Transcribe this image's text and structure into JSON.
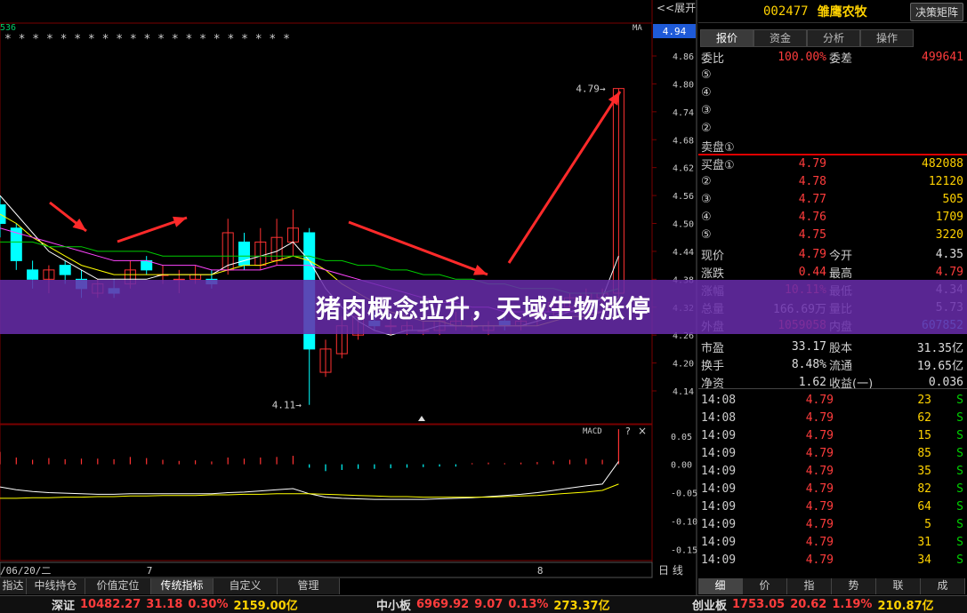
{
  "header": {
    "left_code": "536",
    "ma_label": "MA",
    "expand_label": "<<展开",
    "current_price_badge": "4.94"
  },
  "stock": {
    "code": "002477",
    "name": "雏鹰农牧",
    "decision_btn": "决策矩阵"
  },
  "right_tabs": [
    "报价",
    "资金",
    "分析",
    "操作"
  ],
  "order_ratio": {
    "label1": "委比",
    "value1": "100.00%",
    "label2": "委差",
    "value2": "499641"
  },
  "sell_levels": [
    {
      "label": "⑤",
      "price": "",
      "qty": ""
    },
    {
      "label": "④",
      "price": "",
      "qty": ""
    },
    {
      "label": "③",
      "price": "",
      "qty": ""
    },
    {
      "label": "②",
      "price": "",
      "qty": ""
    },
    {
      "label": "卖盘①",
      "price": "",
      "qty": ""
    }
  ],
  "buy_levels": [
    {
      "label": "买盘①",
      "price": "4.79",
      "qty": "482088"
    },
    {
      "label": "②",
      "price": "4.78",
      "qty": "12120"
    },
    {
      "label": "③",
      "price": "4.77",
      "qty": "505"
    },
    {
      "label": "④",
      "price": "4.76",
      "qty": "1709"
    },
    {
      "label": "⑤",
      "price": "4.75",
      "qty": "3220"
    }
  ],
  "quote_rows": [
    {
      "l1": "现价",
      "v1": "4.79",
      "c1": "red",
      "l2": "今开",
      "v2": "4.35",
      "c2": "wht"
    },
    {
      "l1": "涨跌",
      "v1": "0.44",
      "c1": "red",
      "l2": "最高",
      "v2": "4.79",
      "c2": "red"
    },
    {
      "l1": "涨幅",
      "v1": "10.11%",
      "c1": "red",
      "l2": "最低",
      "v2": "4.34",
      "c2": "wht"
    },
    {
      "l1": "总量",
      "v1": "166.69万",
      "c1": "wht",
      "l2": "量比",
      "v2": "5.73",
      "c2": "wht"
    },
    {
      "l1": "外盘",
      "v1": "1059058",
      "c1": "red",
      "l2": "内盘",
      "v2": "607852",
      "c2": "cyn"
    },
    {
      "l1": "市盈",
      "v1": "33.17",
      "c1": "wht",
      "l2": "股本",
      "v2": "31.35亿",
      "c2": "wht"
    },
    {
      "l1": "换手",
      "v1": "8.48%",
      "c1": "wht",
      "l2": "流通",
      "v2": "19.65亿",
      "c2": "wht"
    },
    {
      "l1": "净资",
      "v1": "1.62",
      "c1": "wht",
      "l2": "收益(一)",
      "v2": "0.036",
      "c2": "wht"
    }
  ],
  "ticks": [
    {
      "time": "14:08",
      "price": "4.79",
      "qty": "23",
      "side": "S"
    },
    {
      "time": "14:08",
      "price": "4.79",
      "qty": "62",
      "side": "S"
    },
    {
      "time": "14:09",
      "price": "4.79",
      "qty": "15",
      "side": "S"
    },
    {
      "time": "14:09",
      "price": "4.79",
      "qty": "85",
      "side": "S"
    },
    {
      "time": "14:09",
      "price": "4.79",
      "qty": "35",
      "side": "S"
    },
    {
      "time": "14:09",
      "price": "4.79",
      "qty": "82",
      "side": "S"
    },
    {
      "time": "14:09",
      "price": "4.79",
      "qty": "64",
      "side": "S"
    },
    {
      "time": "14:09",
      "price": "4.79",
      "qty": "5",
      "side": "S"
    },
    {
      "time": "14:09",
      "price": "4.79",
      "qty": "31",
      "side": "S"
    },
    {
      "time": "14:09",
      "price": "4.79",
      "qty": "34",
      "side": "S"
    }
  ],
  "banner": "猪肉概念拉升，天域生物涨停",
  "bottom_tabs": [
    "指达",
    "中线持仓",
    "价值定位",
    "传统指标",
    "自定义",
    "管理"
  ],
  "right_bottom_tabs": [
    "细",
    "价",
    "指",
    "势",
    "联",
    "成"
  ],
  "status_bar": {
    "sz_label": "深证",
    "sz_index": "10482.27",
    "sz_chg": "31.18",
    "sz_pct": "0.30%",
    "sz_amt": "2159.00亿",
    "zx_label": "中小板",
    "zx_index": "6969.92",
    "zx_chg": "9.07",
    "zx_pct": "0.13%",
    "zx_amt": "273.37亿",
    "cy_label": "创业板",
    "cy_index": "1753.05",
    "cy_chg": "20.62",
    "cy_pct": "1.19%",
    "cy_amt": "210.87亿"
  },
  "chart_data": [
    {
      "type": "candlestick",
      "title": "",
      "y_ticks": [
        "4.86",
        "4.80",
        "4.74",
        "4.68",
        "4.62",
        "4.56",
        "4.50",
        "4.44",
        "4.38",
        "4.32",
        "4.26",
        "4.20",
        "4.14"
      ],
      "x_labels": [
        {
          "label": "/06/20/二",
          "idx": 0
        },
        {
          "label": "7",
          "idx": 9
        },
        {
          "label": "8",
          "idx": 33
        }
      ],
      "period_label": "日 线",
      "star_marks": "*  *  *        *  *          *            *  *  *  *          *  *  *  *  *  *  *  *          *  *        *",
      "high_annotation": "4.79",
      "low_annotation": "4.11",
      "candles": [
        {
          "o": 4.54,
          "h": 4.56,
          "c": 4.5,
          "l": 4.47
        },
        {
          "o": 4.49,
          "h": 4.5,
          "c": 4.42,
          "l": 4.4
        },
        {
          "o": 4.4,
          "h": 4.42,
          "c": 4.38,
          "l": 4.36
        },
        {
          "o": 4.38,
          "h": 4.41,
          "c": 4.4,
          "l": 4.35
        },
        {
          "o": 4.41,
          "h": 4.42,
          "c": 4.39,
          "l": 4.37
        },
        {
          "o": 4.38,
          "h": 4.4,
          "c": 4.36,
          "l": 4.34
        },
        {
          "o": 4.35,
          "h": 4.38,
          "c": 4.37,
          "l": 4.34
        },
        {
          "o": 4.36,
          "h": 4.38,
          "c": 4.35,
          "l": 4.34
        },
        {
          "o": 4.37,
          "h": 4.42,
          "c": 4.4,
          "l": 4.36
        },
        {
          "o": 4.42,
          "h": 4.43,
          "c": 4.4,
          "l": 4.39
        },
        {
          "o": 4.39,
          "h": 4.41,
          "c": 4.39,
          "l": 4.37
        },
        {
          "o": 4.38,
          "h": 4.4,
          "c": 4.38,
          "l": 4.35
        },
        {
          "o": 4.38,
          "h": 4.41,
          "c": 4.39,
          "l": 4.37
        },
        {
          "o": 4.38,
          "h": 4.4,
          "c": 4.37,
          "l": 4.36
        },
        {
          "o": 4.4,
          "h": 4.51,
          "c": 4.48,
          "l": 4.39
        },
        {
          "o": 4.46,
          "h": 4.48,
          "c": 4.41,
          "l": 4.4
        },
        {
          "o": 4.41,
          "h": 4.49,
          "c": 4.46,
          "l": 4.4
        },
        {
          "o": 4.42,
          "h": 4.51,
          "c": 4.47,
          "l": 4.41
        },
        {
          "o": 4.46,
          "h": 4.53,
          "c": 4.49,
          "l": 4.43
        },
        {
          "o": 4.48,
          "h": 4.49,
          "c": 4.23,
          "l": 4.11
        },
        {
          "o": 4.18,
          "h": 4.25,
          "c": 4.23,
          "l": 4.17
        },
        {
          "o": 4.22,
          "h": 4.3,
          "c": 4.28,
          "l": 4.21
        },
        {
          "o": 4.26,
          "h": 4.32,
          "c": 4.3,
          "l": 4.25
        },
        {
          "o": 4.29,
          "h": 4.31,
          "c": 4.28,
          "l": 4.27
        },
        {
          "o": 4.28,
          "h": 4.3,
          "c": 4.28,
          "l": 4.26
        },
        {
          "o": 4.27,
          "h": 4.29,
          "c": 4.28,
          "l": 4.26
        },
        {
          "o": 4.27,
          "h": 4.29,
          "c": 4.27,
          "l": 4.26
        },
        {
          "o": 4.27,
          "h": 4.3,
          "c": 4.29,
          "l": 4.26
        },
        {
          "o": 4.28,
          "h": 4.31,
          "c": 4.29,
          "l": 4.27
        },
        {
          "o": 4.28,
          "h": 4.3,
          "c": 4.28,
          "l": 4.27
        },
        {
          "o": 4.27,
          "h": 4.29,
          "c": 4.28,
          "l": 4.26
        },
        {
          "o": 4.29,
          "h": 4.3,
          "c": 4.28,
          "l": 4.27
        },
        {
          "o": 4.28,
          "h": 4.3,
          "c": 4.29,
          "l": 4.27
        },
        {
          "o": 4.3,
          "h": 4.33,
          "c": 4.31,
          "l": 4.28
        },
        {
          "o": 4.31,
          "h": 4.34,
          "c": 4.33,
          "l": 4.3
        },
        {
          "o": 4.32,
          "h": 4.35,
          "c": 4.34,
          "l": 4.31
        },
        {
          "o": 4.33,
          "h": 4.36,
          "c": 4.35,
          "l": 4.32
        },
        {
          "o": 4.34,
          "h": 4.36,
          "c": 4.35,
          "l": 4.33
        },
        {
          "o": 4.35,
          "h": 4.79,
          "c": 4.79,
          "l": 4.34
        }
      ],
      "ma_lines": [
        {
          "color": "#ffffff",
          "values": [
            4.56,
            4.52,
            4.48,
            4.44,
            4.42,
            4.4,
            4.38,
            4.38,
            4.38,
            4.38,
            4.39,
            4.39,
            4.39,
            4.39,
            4.41,
            4.42,
            4.43,
            4.44,
            4.46,
            4.42,
            4.36,
            4.32,
            4.29,
            4.27,
            4.26,
            4.27,
            4.27,
            4.28,
            4.28,
            4.28,
            4.28,
            4.28,
            4.28,
            4.29,
            4.3,
            4.31,
            4.32,
            4.34,
            4.43
          ]
        },
        {
          "color": "#ffff00",
          "values": [
            4.52,
            4.5,
            4.47,
            4.45,
            4.43,
            4.41,
            4.4,
            4.39,
            4.39,
            4.39,
            4.39,
            4.39,
            4.39,
            4.39,
            4.4,
            4.41,
            4.41,
            4.42,
            4.43,
            4.42,
            4.4,
            4.37,
            4.35,
            4.33,
            4.31,
            4.3,
            4.29,
            4.29,
            4.28,
            4.28,
            4.28,
            4.28,
            4.28,
            4.28,
            4.29,
            4.3,
            4.3,
            4.31,
            4.34
          ]
        },
        {
          "color": "#ff44ff",
          "values": [
            4.49,
            4.48,
            4.47,
            4.46,
            4.45,
            4.44,
            4.43,
            4.42,
            4.42,
            4.42,
            4.41,
            4.41,
            4.41,
            4.4,
            4.4,
            4.4,
            4.4,
            4.41,
            4.41,
            4.41,
            4.4,
            4.39,
            4.38,
            4.37,
            4.36,
            4.35,
            4.34,
            4.33,
            4.33,
            4.32,
            4.32,
            4.31,
            4.31,
            4.31,
            4.31,
            4.31,
            4.31,
            4.31,
            4.33
          ]
        },
        {
          "color": "#00cc00",
          "values": [
            4.46,
            4.46,
            4.46,
            4.45,
            4.45,
            4.45,
            4.44,
            4.44,
            4.44,
            4.44,
            4.43,
            4.43,
            4.43,
            4.43,
            4.43,
            4.43,
            4.43,
            4.43,
            4.43,
            4.43,
            4.42,
            4.42,
            4.41,
            4.41,
            4.4,
            4.4,
            4.39,
            4.39,
            4.38,
            4.38,
            4.37,
            4.37,
            4.36,
            4.36,
            4.36,
            4.35,
            4.35,
            4.35,
            4.36
          ]
        }
      ]
    },
    {
      "type": "macd",
      "label": "MACD",
      "y_ticks": [
        "0.05",
        "0.00",
        "-0.05",
        "-0.10",
        "-0.15"
      ],
      "ylim": [
        -0.17,
        0.07
      ],
      "histogram": [
        0.022,
        0.012,
        0.008,
        0.011,
        0.009,
        0.01,
        0.01,
        0.009,
        0.013,
        0.011,
        0.008,
        0.006,
        0.007,
        0.005,
        0.012,
        0.01,
        0.012,
        0.013,
        0.015,
        -0.006,
        -0.012,
        -0.01,
        -0.008,
        -0.008,
        -0.007,
        -0.006,
        -0.005,
        -0.004,
        -0.004,
        0.002,
        0.003,
        0.002,
        0.003,
        0.004,
        0.006,
        0.008,
        0.01,
        0.008,
        0.062
      ],
      "diff": [
        -0.04,
        -0.045,
        -0.048,
        -0.05,
        -0.051,
        -0.052,
        -0.053,
        -0.053,
        -0.052,
        -0.052,
        -0.052,
        -0.052,
        -0.052,
        -0.052,
        -0.05,
        -0.049,
        -0.047,
        -0.045,
        -0.043,
        -0.052,
        -0.058,
        -0.06,
        -0.061,
        -0.062,
        -0.062,
        -0.062,
        -0.062,
        -0.061,
        -0.06,
        -0.059,
        -0.057,
        -0.055,
        -0.053,
        -0.05,
        -0.046,
        -0.042,
        -0.038,
        -0.035,
        0.005
      ],
      "dea": [
        -0.06,
        -0.06,
        -0.059,
        -0.059,
        -0.058,
        -0.058,
        -0.057,
        -0.057,
        -0.056,
        -0.056,
        -0.055,
        -0.055,
        -0.055,
        -0.054,
        -0.054,
        -0.053,
        -0.053,
        -0.052,
        -0.052,
        -0.052,
        -0.053,
        -0.054,
        -0.055,
        -0.056,
        -0.057,
        -0.057,
        -0.058,
        -0.058,
        -0.058,
        -0.058,
        -0.058,
        -0.057,
        -0.056,
        -0.055,
        -0.053,
        -0.051,
        -0.049,
        -0.046,
        -0.035
      ]
    }
  ]
}
